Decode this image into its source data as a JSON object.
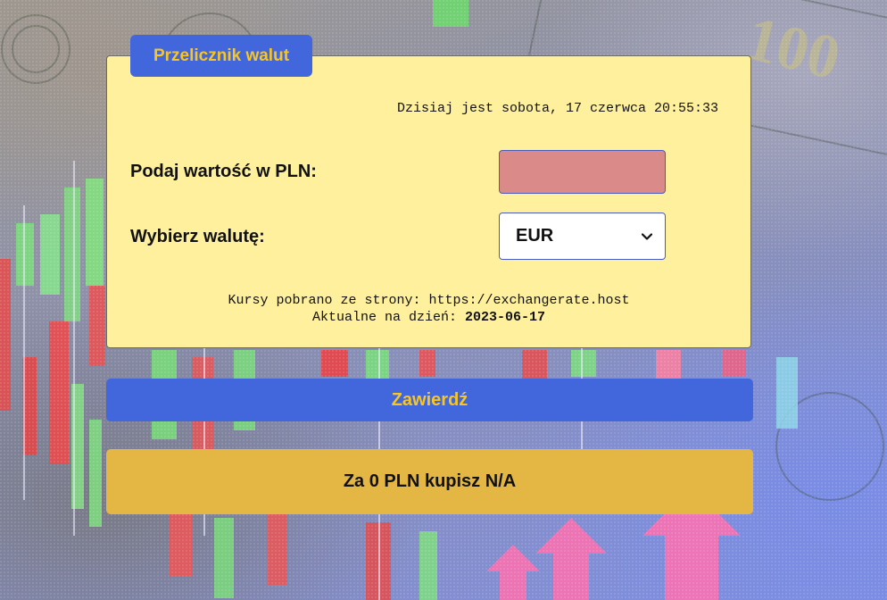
{
  "form": {
    "title": "Przelicznik walut",
    "datetime_text": "Dzisiaj jest sobota, 17 czerwca 20:55:33",
    "amount_label": "Podaj wartość w PLN:",
    "amount_value": "",
    "currency_label": "Wybierz walutę:",
    "currency_selected": "EUR",
    "source_line": "Kursy pobrano ze strony: https://exchangerate.host",
    "date_line_prefix": "Aktualne na dzień: ",
    "date_line_value": "2023-06-17"
  },
  "actions": {
    "submit_label": "Zawierdź"
  },
  "result": {
    "text": "Za 0 PLN kupisz N/A"
  },
  "colors": {
    "panel_background": "#fef09d",
    "accent_blue": "#4267dd",
    "accent_yellow": "#f7c524",
    "input_background": "#db8a8a",
    "result_background": "#e4b744"
  },
  "background": {
    "image": "candlestick-chart-and-banknotes"
  }
}
